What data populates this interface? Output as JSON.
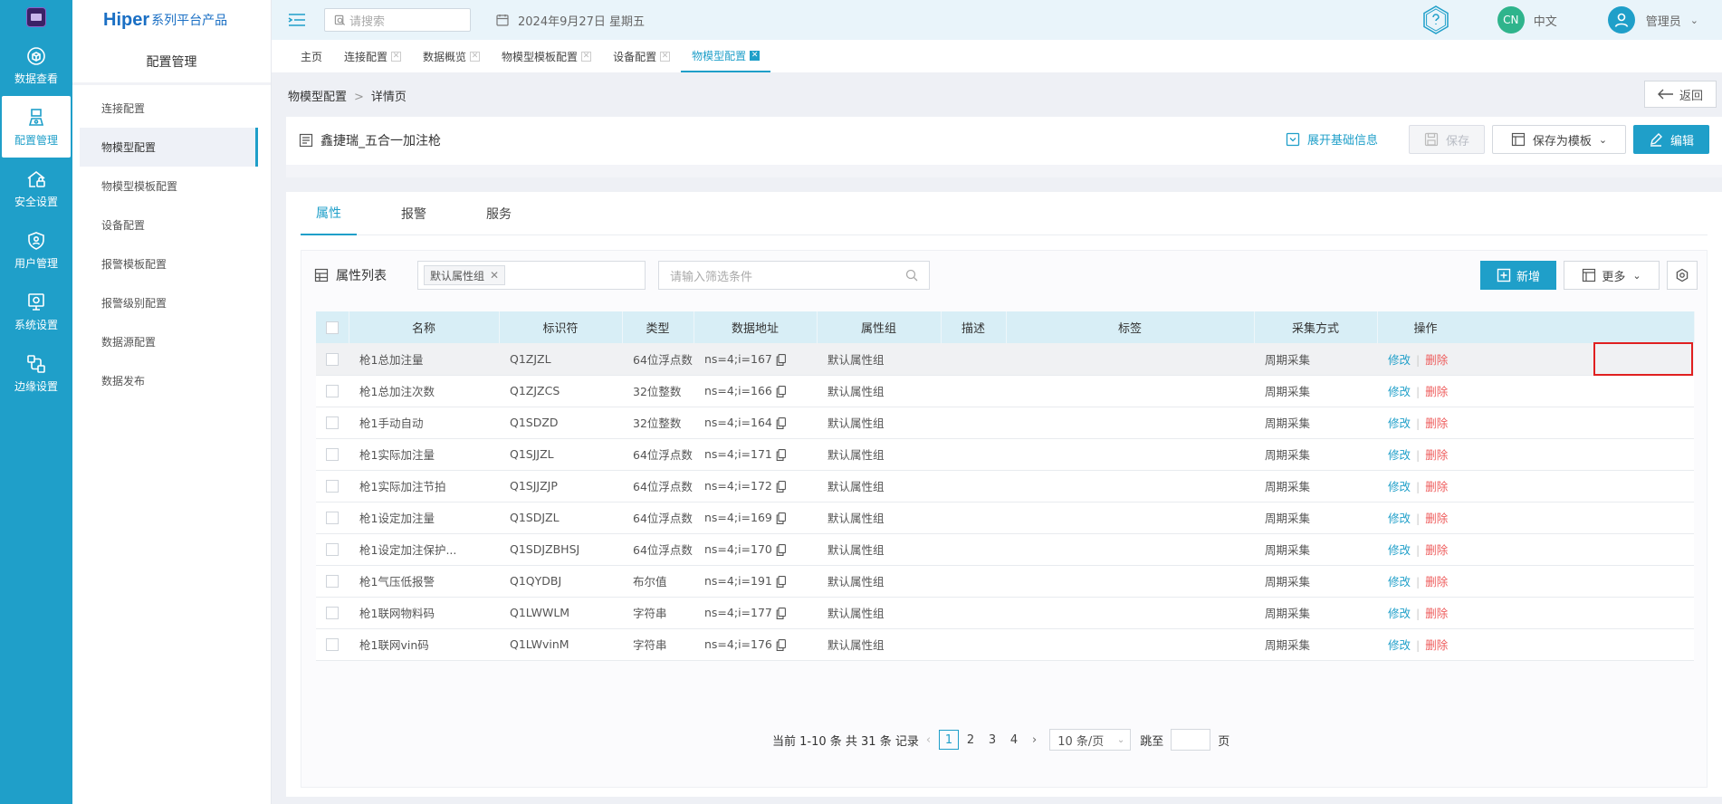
{
  "rail": {
    "items": [
      {
        "label": "数据查看",
        "icon": "cube-icon"
      },
      {
        "label": "配置管理",
        "icon": "config-icon"
      },
      {
        "label": "安全设置",
        "icon": "house-lock-icon"
      },
      {
        "label": "用户管理",
        "icon": "shield-user-icon"
      },
      {
        "label": "系统设置",
        "icon": "system-icon"
      },
      {
        "label": "边缘设置",
        "icon": "edge-icon"
      }
    ]
  },
  "brand": {
    "name": "Hiper",
    "suffix": "系列平台产品"
  },
  "sidebar": {
    "title": "配置管理",
    "items": [
      "连接配置",
      "物模型配置",
      "物模型模板配置",
      "设备配置",
      "报警模板配置",
      "报警级别配置",
      "数据源配置",
      "数据发布"
    ]
  },
  "header": {
    "search_placeholder": "请搜索",
    "date": "2024年9月27日 星期五",
    "lang_badge": "CN",
    "lang_label": "中文",
    "user_name": "管理员"
  },
  "tabs": [
    "主页",
    "连接配置",
    "数据概览",
    "物模型模板配置",
    "设备配置",
    "物模型配置"
  ],
  "breadcrumb": {
    "parent": "物模型配置",
    "sep": ">",
    "current": "详情页"
  },
  "back_label": "返回",
  "device": {
    "title": "鑫捷瑞_五合一加注枪",
    "expand_label": "展开基础信息",
    "save_label": "保存",
    "save_template_label": "保存为模板",
    "edit_label": "编辑"
  },
  "panel_tabs": [
    "属性",
    "报警",
    "服务"
  ],
  "list": {
    "title": "属性列表",
    "group_tag": "默认属性组",
    "filter_placeholder": "请输入筛选条件",
    "add_label": "新增",
    "more_label": "更多"
  },
  "table": {
    "columns": [
      "名称",
      "标识符",
      "类型",
      "数据地址",
      "属性组",
      "描述",
      "标签",
      "采集方式",
      "操作"
    ],
    "rows": [
      {
        "name": "枪1总加注量",
        "id": "Q1ZJZL",
        "type": "64位浮点数",
        "addr": "ns=4;i=167",
        "group": "默认属性组",
        "desc": "",
        "tag": "",
        "mode": "周期采集"
      },
      {
        "name": "枪1总加注次数",
        "id": "Q1ZJZCS",
        "type": "32位整数",
        "addr": "ns=4;i=166",
        "group": "默认属性组",
        "desc": "",
        "tag": "",
        "mode": "周期采集"
      },
      {
        "name": "枪1手动自动",
        "id": "Q1SDZD",
        "type": "32位整数",
        "addr": "ns=4;i=164",
        "group": "默认属性组",
        "desc": "",
        "tag": "",
        "mode": "周期采集"
      },
      {
        "name": "枪1实际加注量",
        "id": "Q1SJJZL",
        "type": "64位浮点数",
        "addr": "ns=4;i=171",
        "group": "默认属性组",
        "desc": "",
        "tag": "",
        "mode": "周期采集"
      },
      {
        "name": "枪1实际加注节拍",
        "id": "Q1SJJZJP",
        "type": "64位浮点数",
        "addr": "ns=4;i=172",
        "group": "默认属性组",
        "desc": "",
        "tag": "",
        "mode": "周期采集"
      },
      {
        "name": "枪1设定加注量",
        "id": "Q1SDJZL",
        "type": "64位浮点数",
        "addr": "ns=4;i=169",
        "group": "默认属性组",
        "desc": "",
        "tag": "",
        "mode": "周期采集"
      },
      {
        "name": "枪1设定加注保护...",
        "id": "Q1SDJZBHSJ",
        "type": "64位浮点数",
        "addr": "ns=4;i=170",
        "group": "默认属性组",
        "desc": "",
        "tag": "",
        "mode": "周期采集"
      },
      {
        "name": "枪1气压低报警",
        "id": "Q1QYDBJ",
        "type": "布尔值",
        "addr": "ns=4;i=191",
        "group": "默认属性组",
        "desc": "",
        "tag": "",
        "mode": "周期采集"
      },
      {
        "name": "枪1联网物料码",
        "id": "Q1LWWLM",
        "type": "字符串",
        "addr": "ns=4;i=177",
        "group": "默认属性组",
        "desc": "",
        "tag": "",
        "mode": "周期采集"
      },
      {
        "name": "枪1联网vin码",
        "id": "Q1LWvinM",
        "type": "字符串",
        "addr": "ns=4;i=176",
        "group": "默认属性组",
        "desc": "",
        "tag": "",
        "mode": "周期采集"
      }
    ],
    "edit_label": "修改",
    "delete_label": "删除"
  },
  "pagination": {
    "summary": "当前 1-10 条 共 31 条 记录",
    "pages": [
      "1",
      "2",
      "3",
      "4"
    ],
    "current": "1",
    "page_size": "10 条/页",
    "jump_label": "跳至",
    "page_unit": "页"
  },
  "colors": {
    "accent": "#1f9fc9",
    "danger": "#ee5b5b",
    "highlight_box": "#e02020"
  }
}
